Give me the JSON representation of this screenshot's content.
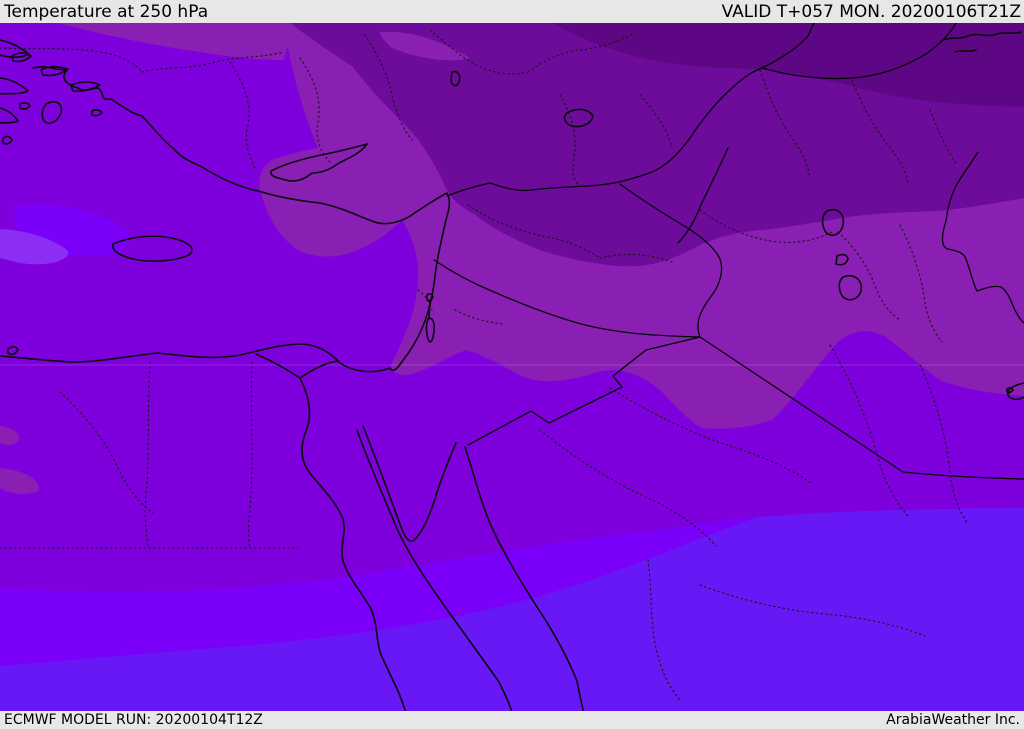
{
  "header": {
    "title": "Temperature at 250 hPa",
    "valid_label": "VALID T+057 MON. 20200106T21Z"
  },
  "footer": {
    "model_run": "ECMWF MODEL RUN: 20200104T12Z",
    "provider": "ArabiaWeather Inc."
  },
  "map": {
    "colors": {
      "band_vivid": "#7e00dc",
      "band_dark": "#6d0b9a",
      "band_darkest": "#5e0784",
      "band_medium": "#8a1fb4",
      "band_bright": "#7a00fa",
      "band_light_patch": "#8b2df2",
      "band_blue": "#6818f5",
      "coastline": "#0a0a0a",
      "border": "#050505",
      "admin_boundary": "#161616",
      "chrome_bg": "#e7e7e7",
      "chrome_text": "#000000"
    }
  }
}
